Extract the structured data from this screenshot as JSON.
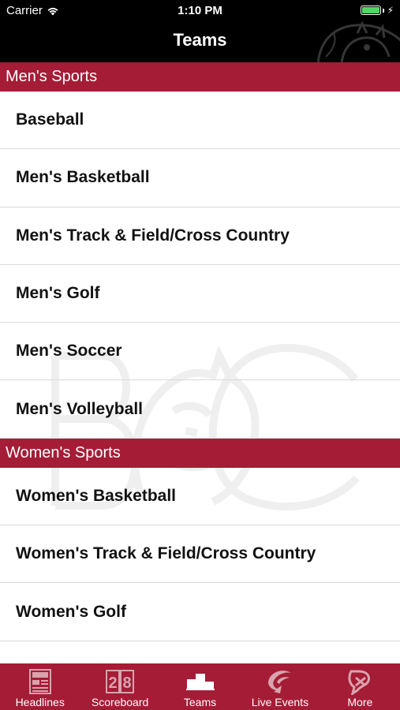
{
  "status_bar": {
    "carrier": "Carrier",
    "time": "1:10 PM",
    "battery_level": 1.0
  },
  "nav": {
    "title": "Teams"
  },
  "sections": [
    {
      "header": "Men's Sports",
      "items": [
        "Baseball",
        "Men's Basketball",
        "Men's Track & Field/Cross Country",
        "Men's Golf",
        "Men's Soccer",
        "Men's Volleyball"
      ]
    },
    {
      "header": "Women's Sports",
      "items": [
        "Women's Basketball",
        "Women's Track & Field/Cross Country",
        "Women's Golf"
      ]
    }
  ],
  "tabs": [
    {
      "label": "Headlines",
      "icon": "newspaper-icon"
    },
    {
      "label": "Scoreboard",
      "icon": "scoreboard-icon"
    },
    {
      "label": "Teams",
      "icon": "podium-icon",
      "selected": true
    },
    {
      "label": "Live Events",
      "icon": "live-events-icon"
    },
    {
      "label": "More",
      "icon": "more-icon"
    }
  ],
  "colors": {
    "accent": "#a51c36",
    "nav_background": "#000000",
    "battery": "#4cd964"
  }
}
